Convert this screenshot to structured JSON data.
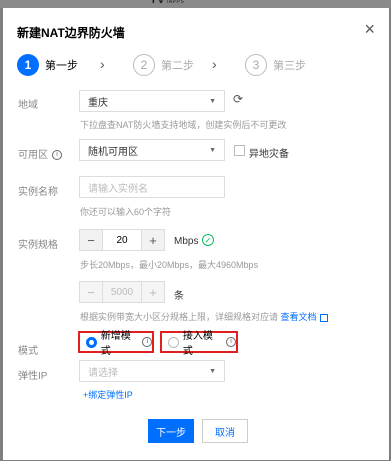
{
  "title": "新建NAT边界防火墙",
  "steps": [
    {
      "num": "1",
      "label": "第一步"
    },
    {
      "num": "2",
      "label": "第二步"
    },
    {
      "num": "3",
      "label": "第三步"
    }
  ],
  "region": {
    "label": "地域",
    "value": "重庆",
    "hint": "下拉盘查NAT防火墙支持地域，创建实例后不可更改"
  },
  "zone": {
    "label": "可用区",
    "value": "随机可用区",
    "checkbox_label": "异地灾备"
  },
  "instance_name": {
    "label": "实例名称",
    "placeholder": "请输入实例名",
    "hint": "你还可以输入60个字符"
  },
  "spec": {
    "label": "实例规格",
    "bandwidth_value": "20",
    "bandwidth_unit": "Mbps",
    "bandwidth_hint": "步长20Mbps，最小20Mbps，最大4960Mbps",
    "count_value": "5000",
    "count_unit": "条",
    "count_hint": "根据实例带宽大小区分规格上限，详细规格对应请",
    "doc_link": "查看文档"
  },
  "mode": {
    "label": "模式",
    "option_new": "新增模式",
    "option_access": "接入模式",
    "selected": "新增模式"
  },
  "eip": {
    "label": "弹性IP",
    "placeholder": "请选择",
    "bind_link": "+绑定弹性IP"
  },
  "footer": {
    "next_label": "下一步",
    "cancel_label": "取消"
  },
  "colors": {
    "accent": "#006eff",
    "highlight": "#e02020",
    "success": "#0abf5b"
  }
}
